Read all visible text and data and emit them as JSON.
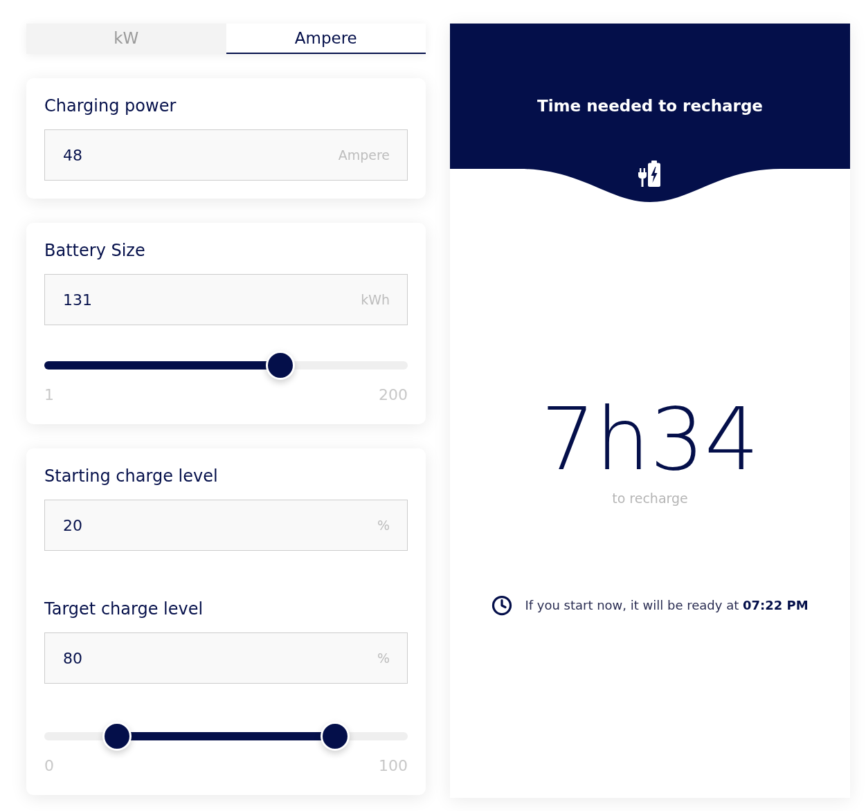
{
  "unit_tabs": [
    {
      "label": "kW",
      "selected": false
    },
    {
      "label": "Ampere",
      "selected": true
    }
  ],
  "cards": [
    {
      "fields": [
        {
          "label": "Charging power",
          "value": "48",
          "unit": "Ampere"
        }
      ]
    },
    {
      "fields": [
        {
          "label": "Battery Size",
          "value": "131",
          "unit": "kWh"
        }
      ],
      "slider": {
        "thumbs": [
          {
            "level": 0.65
          }
        ],
        "min_label": "1",
        "max_label": "200"
      }
    },
    {
      "fields": [
        {
          "label": "Starting charge level",
          "value": "20",
          "unit": "%"
        },
        {
          "label": "Target charge level",
          "value": "80",
          "unit": "%"
        }
      ],
      "slider": {
        "thumbs": [
          {
            "level": 0.2
          },
          {
            "level": 0.8
          }
        ],
        "min_label": "0",
        "max_label": "100"
      }
    }
  ],
  "result": {
    "title": "Time needed to recharge",
    "duration": "7h34",
    "caption": "to recharge",
    "ready_note": "If you start now, it will be ready at **07:22 PM**"
  }
}
